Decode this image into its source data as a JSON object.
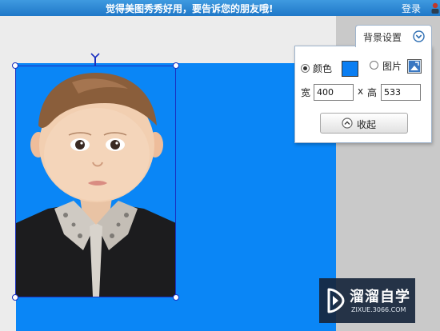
{
  "topbar": {
    "share_text": "觉得美图秀秀好用，要告诉您的朋友哦!",
    "login_label": "登录"
  },
  "background_panel": {
    "tab_title": "背景设置",
    "option_color_label": "颜色",
    "option_image_label": "图片",
    "selected_option": "颜色",
    "color_value": "#0a7ef2",
    "width_label": "宽",
    "width_value": "400",
    "times_symbol": "x",
    "height_label": "高",
    "height_value": "533",
    "collapse_label": "收起"
  },
  "canvas": {
    "background_color": "#0a86f6"
  },
  "watermark": {
    "brand": "溜溜自学",
    "site": "ZIXUE.3066.COM"
  },
  "colors": {
    "topbar": "#2a86d4",
    "selection": "#1a2fc0",
    "canvas_background": "#0a86f6"
  }
}
